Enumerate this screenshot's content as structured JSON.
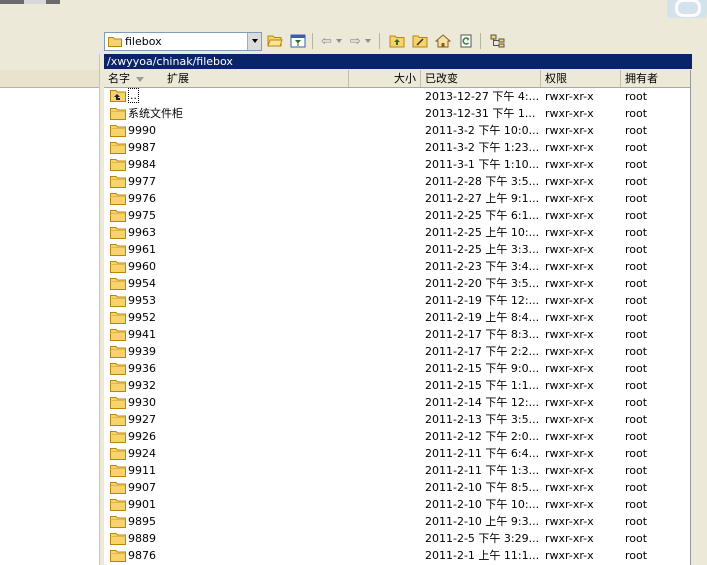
{
  "toolbar": {
    "path_combo_value": "filebox",
    "back_arrow": "⇦",
    "forward_arrow": "⇨"
  },
  "pathbar": {
    "text": "/xwyyoa/chinak/filebox"
  },
  "columns": {
    "name": "名字",
    "ext": "扩展",
    "size": "大小",
    "modified": "已改变",
    "permissions": "权限",
    "owner": "拥有者"
  },
  "files": [
    {
      "name": "..",
      "modified": "2013-12-27 下午 4:...",
      "perm": "rwxr-xr-x",
      "owner": "root",
      "parent": true
    },
    {
      "name": "系统文件柜",
      "modified": "2013-12-31 下午 1...",
      "perm": "rwxr-xr-x",
      "owner": "root"
    },
    {
      "name": "9990",
      "modified": "2011-3-2 下午 10:0...",
      "perm": "rwxr-xr-x",
      "owner": "root"
    },
    {
      "name": "9987",
      "modified": "2011-3-2 下午 1:23...",
      "perm": "rwxr-xr-x",
      "owner": "root"
    },
    {
      "name": "9984",
      "modified": "2011-3-1 下午 1:10...",
      "perm": "rwxr-xr-x",
      "owner": "root"
    },
    {
      "name": "9977",
      "modified": "2011-2-28 下午 3:5...",
      "perm": "rwxr-xr-x",
      "owner": "root"
    },
    {
      "name": "9976",
      "modified": "2011-2-27 上午 9:1...",
      "perm": "rwxr-xr-x",
      "owner": "root"
    },
    {
      "name": "9975",
      "modified": "2011-2-25 下午 6:1...",
      "perm": "rwxr-xr-x",
      "owner": "root"
    },
    {
      "name": "9963",
      "modified": "2011-2-25 上午 10:...",
      "perm": "rwxr-xr-x",
      "owner": "root"
    },
    {
      "name": "9961",
      "modified": "2011-2-25 上午 3:3...",
      "perm": "rwxr-xr-x",
      "owner": "root"
    },
    {
      "name": "9960",
      "modified": "2011-2-23 下午 3:4...",
      "perm": "rwxr-xr-x",
      "owner": "root"
    },
    {
      "name": "9954",
      "modified": "2011-2-20 下午 3:5...",
      "perm": "rwxr-xr-x",
      "owner": "root"
    },
    {
      "name": "9953",
      "modified": "2011-2-19 下午 12:...",
      "perm": "rwxr-xr-x",
      "owner": "root"
    },
    {
      "name": "9952",
      "modified": "2011-2-19 上午 8:4...",
      "perm": "rwxr-xr-x",
      "owner": "root"
    },
    {
      "name": "9941",
      "modified": "2011-2-17 下午 8:3...",
      "perm": "rwxr-xr-x",
      "owner": "root"
    },
    {
      "name": "9939",
      "modified": "2011-2-17 下午 2:2...",
      "perm": "rwxr-xr-x",
      "owner": "root"
    },
    {
      "name": "9936",
      "modified": "2011-2-15 下午 9:0...",
      "perm": "rwxr-xr-x",
      "owner": "root"
    },
    {
      "name": "9932",
      "modified": "2011-2-15 下午 1:1...",
      "perm": "rwxr-xr-x",
      "owner": "root"
    },
    {
      "name": "9930",
      "modified": "2011-2-14 下午 12:...",
      "perm": "rwxr-xr-x",
      "owner": "root"
    },
    {
      "name": "9927",
      "modified": "2011-2-13 下午 3:5...",
      "perm": "rwxr-xr-x",
      "owner": "root"
    },
    {
      "name": "9926",
      "modified": "2011-2-12 下午 2:0...",
      "perm": "rwxr-xr-x",
      "owner": "root"
    },
    {
      "name": "9924",
      "modified": "2011-2-11 下午 6:4...",
      "perm": "rwxr-xr-x",
      "owner": "root"
    },
    {
      "name": "9911",
      "modified": "2011-2-11 下午 1:3...",
      "perm": "rwxr-xr-x",
      "owner": "root"
    },
    {
      "name": "9907",
      "modified": "2011-2-10 下午 8:5...",
      "perm": "rwxr-xr-x",
      "owner": "root"
    },
    {
      "name": "9901",
      "modified": "2011-2-10 下午 10:...",
      "perm": "rwxr-xr-x",
      "owner": "root"
    },
    {
      "name": "9895",
      "modified": "2011-2-10 上午 9:3...",
      "perm": "rwxr-xr-x",
      "owner": "root"
    },
    {
      "name": "9889",
      "modified": "2011-2-5 下午 3:29...",
      "perm": "rwxr-xr-x",
      "owner": "root"
    },
    {
      "name": "9876",
      "modified": "2011-2-1 上午 11:1...",
      "perm": "rwxr-xr-x",
      "owner": "root"
    }
  ],
  "colors": {
    "pathbar_bg": "#0a246a",
    "folder": "#f7d36b"
  }
}
